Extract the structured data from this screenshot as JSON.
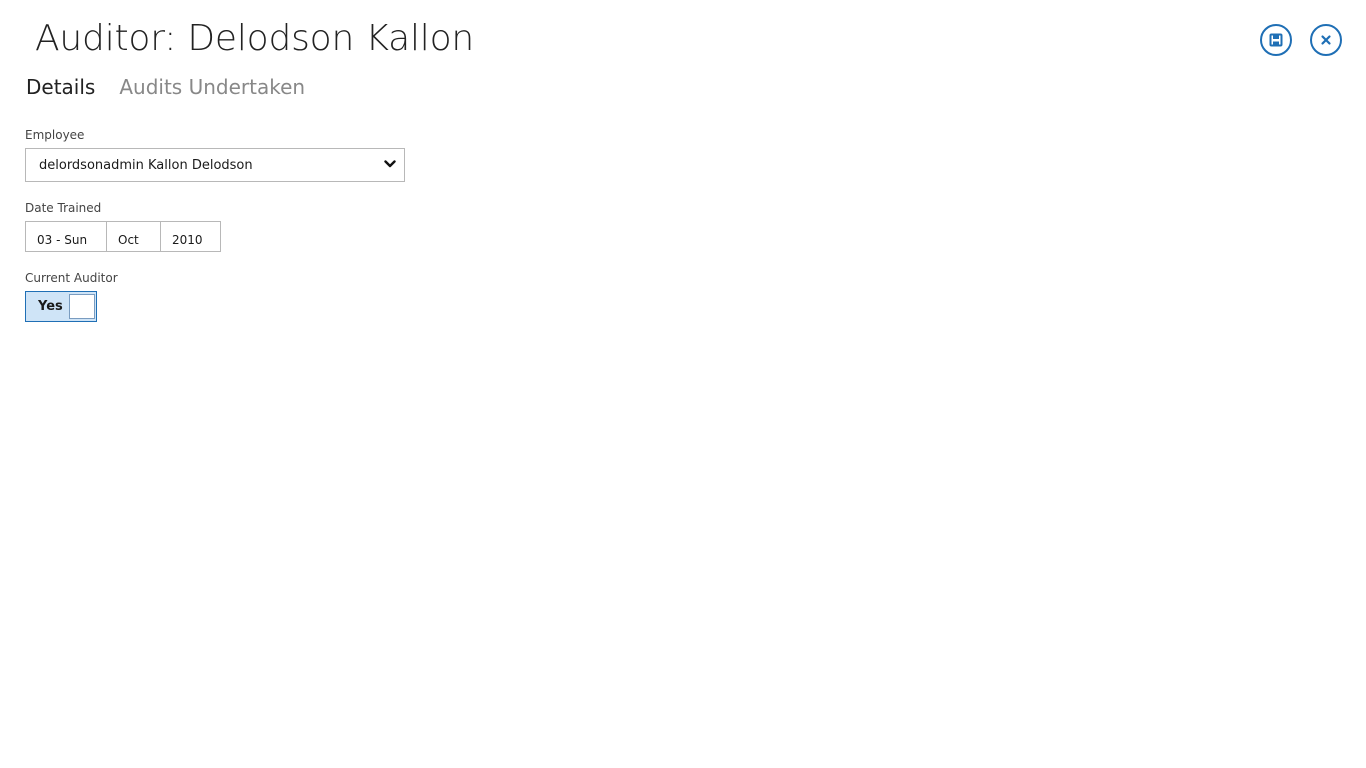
{
  "header": {
    "title": "Auditor: Delodson Kallon"
  },
  "actions": {
    "save_icon": "save-icon",
    "close_icon": "close-icon",
    "accent_color": "#1f6fb5"
  },
  "tabs": [
    {
      "label": "Details",
      "active": true
    },
    {
      "label": "Audits Undertaken",
      "active": false
    }
  ],
  "form": {
    "employee": {
      "label": "Employee",
      "value": "delordsonadmin Kallon Delodson"
    },
    "date_trained": {
      "label": "Date Trained",
      "day": "03 - Sun",
      "month": "Oct",
      "year": "2010"
    },
    "current_auditor": {
      "label": "Current Auditor",
      "value": "Yes"
    }
  }
}
